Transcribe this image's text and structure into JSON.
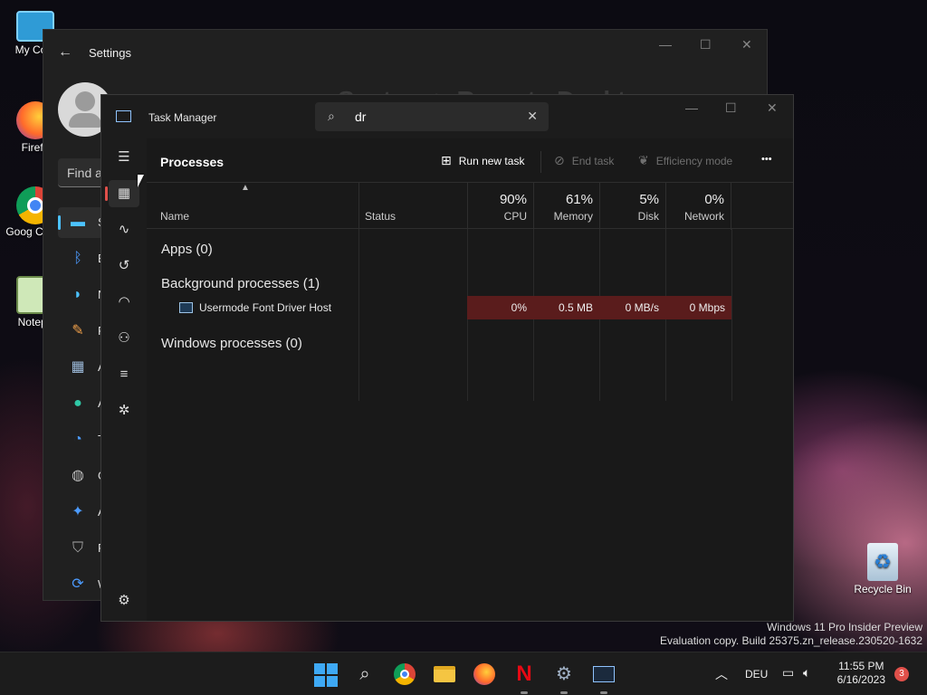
{
  "desktop": {
    "icons": [
      {
        "label": "My Com"
      },
      {
        "label": "Firefo"
      },
      {
        "label": "Goog Chron"
      },
      {
        "label": "Notepa"
      },
      {
        "label": "Recycle Bin"
      }
    ]
  },
  "settings": {
    "title": "Settings",
    "find_placeholder": "Find a",
    "heading": "System  >  Remote Desktop",
    "nav": [
      {
        "label": "S",
        "icon": "system-icon"
      },
      {
        "label": "B",
        "icon": "bluetooth-icon"
      },
      {
        "label": "N",
        "icon": "network-icon"
      },
      {
        "label": "P",
        "icon": "personalization-icon"
      },
      {
        "label": "A",
        "icon": "apps-icon"
      },
      {
        "label": "A",
        "icon": "accounts-icon"
      },
      {
        "label": "T",
        "icon": "time-language-icon"
      },
      {
        "label": "G",
        "icon": "gaming-icon"
      },
      {
        "label": "A",
        "icon": "accessibility-icon"
      },
      {
        "label": "P",
        "icon": "privacy-icon"
      },
      {
        "label": "W",
        "icon": "windows-update-icon"
      }
    ]
  },
  "taskmanager": {
    "title": "Task Manager",
    "search": {
      "value": "dr"
    },
    "page_title": "Processes",
    "toolbar": {
      "run_new_task": "Run new task",
      "end_task": "End task",
      "efficiency_mode": "Efficiency mode",
      "more": "•••"
    },
    "columns": {
      "name": "Name",
      "status": "Status",
      "cpu": {
        "pct": "90%",
        "label": "CPU"
      },
      "memory": {
        "pct": "61%",
        "label": "Memory"
      },
      "disk": {
        "pct": "5%",
        "label": "Disk"
      },
      "network": {
        "pct": "0%",
        "label": "Network"
      }
    },
    "groups": {
      "apps": "Apps (0)",
      "background": "Background processes (1)",
      "windows": "Windows processes (0)"
    },
    "process": {
      "name": "Usermode Font Driver Host",
      "cpu": "0%",
      "memory": "0.5 MB",
      "disk": "0 MB/s",
      "network": "0 Mbps"
    }
  },
  "watermark": {
    "line1": "Windows 11 Pro Insider Preview",
    "line2": "Evaluation copy. Build 25375.zn_release.230520-1632"
  },
  "taskbar": {
    "language": "DEU",
    "time": "11:55 PM",
    "date": "6/16/2023",
    "notifications": "3"
  },
  "colors": {
    "accent_settings": "#4cc2ff",
    "accent_taskmanager": "#e0504a",
    "heat_cell": "#5a1c1c"
  }
}
